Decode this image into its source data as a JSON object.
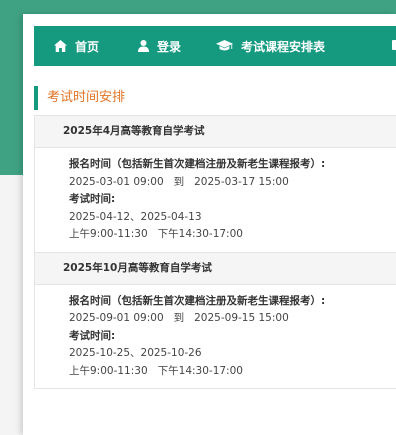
{
  "nav": {
    "items": [
      {
        "label": "首页",
        "icon": "home-icon"
      },
      {
        "label": "登录",
        "icon": "user-icon"
      },
      {
        "label": "考试课程安排表",
        "icon": "graduation-cap-icon"
      }
    ]
  },
  "section": {
    "title": "考试时间安排"
  },
  "exams": [
    {
      "title": "2025年4月高等教育自学考试",
      "reg_label": "报名时间（包括新生首次建档注册及新老生课程报考）:",
      "reg_start": "2025-03-01 09:00",
      "reg_to": "到",
      "reg_end": "2025-03-17 15:00",
      "exam_label": "考试时间:",
      "exam_dates": "2025-04-12、2025-04-13",
      "morning": "上午9:00-11:30",
      "afternoon": "下午14:30-17:00"
    },
    {
      "title": "2025年10月高等教育自学考试",
      "reg_label": "报名时间（包括新生首次建档注册及新老生课程报考）:",
      "reg_start": "2025-09-01 09:00",
      "reg_to": "到",
      "reg_end": "2025-09-15 15:00",
      "exam_label": "考试时间:",
      "exam_dates": "2025-10-25、2025-10-26",
      "morning": "上午9:00-11:30",
      "afternoon": "下午14:30-17:00"
    }
  ],
  "colors": {
    "nav_bg": "#159a80",
    "band_bg": "#3fa383",
    "title_accent": "#e27426"
  }
}
